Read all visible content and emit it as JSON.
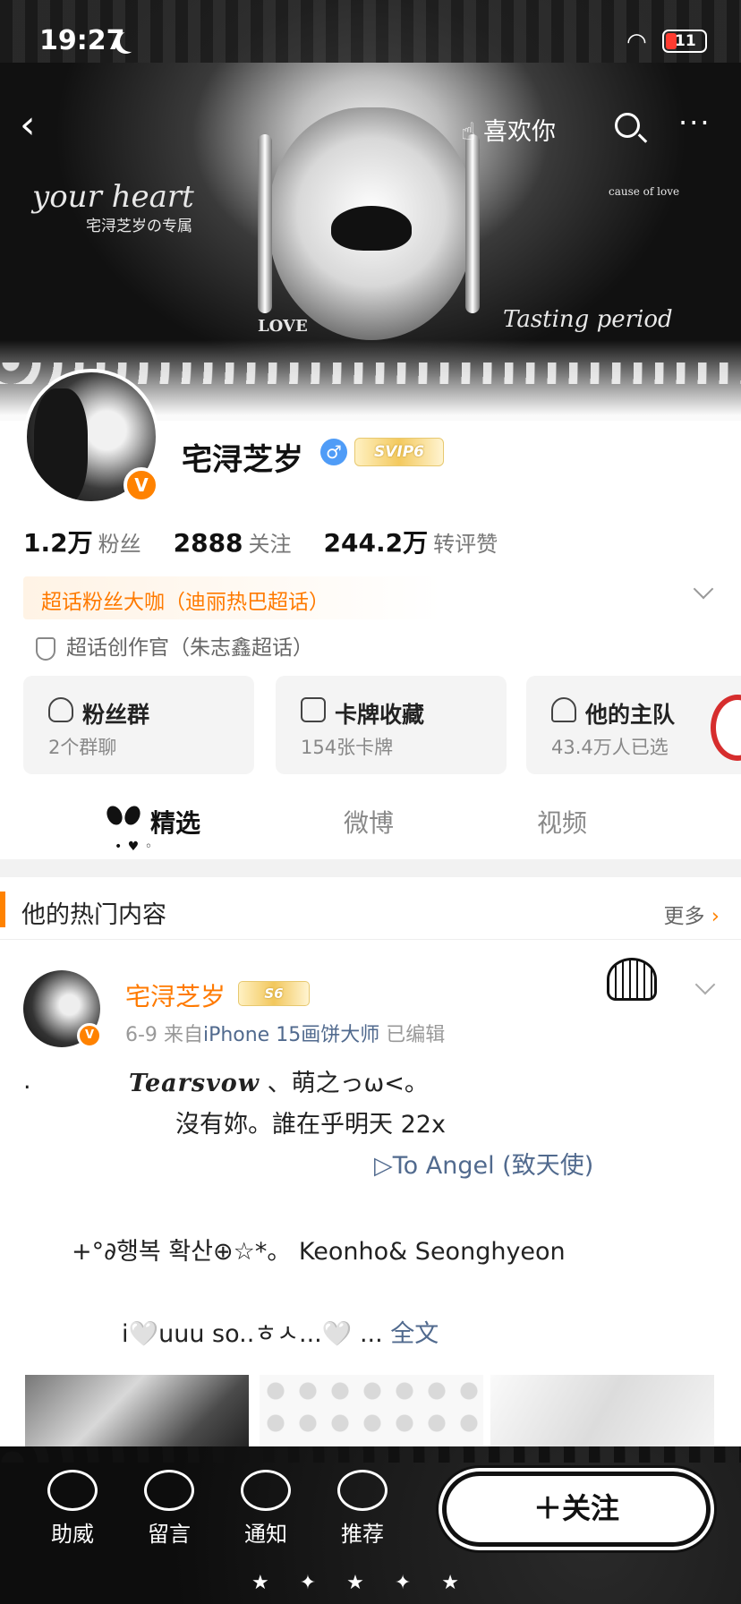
{
  "status_bar": {
    "time": "19:27",
    "battery": "11"
  },
  "nav": {
    "like_label": "喜欢你"
  },
  "banner": {
    "script_text": "your heart",
    "sub_text": "宅浔芝岁の专属",
    "tagline": "Tasting period",
    "love_text": "LOVE",
    "cause_text": "cause of love"
  },
  "profile": {
    "name": "宅浔芝岁",
    "verified_mark": "V",
    "gender_mark": "♂",
    "vip_badge": "SVIP6",
    "stats": [
      {
        "value": "1.2万",
        "label": "粉丝"
      },
      {
        "value": "2888",
        "label": "关注"
      },
      {
        "value": "244.2万",
        "label": "转评赞"
      }
    ],
    "super_fan": "超话粉丝大咖（迪丽热巴超话）",
    "creator": "超话创作官（朱志鑫超话）"
  },
  "cards": [
    {
      "title": "粉丝群",
      "sub": "2个群聊"
    },
    {
      "title": "卡牌收藏",
      "sub": "154张卡牌"
    },
    {
      "title": "他的主队",
      "sub": "43.4万人已选"
    }
  ],
  "tabs": [
    {
      "label": "精选",
      "active": true
    },
    {
      "label": "微博",
      "active": false
    },
    {
      "label": "视频",
      "active": false
    }
  ],
  "section": {
    "title": "他的热门内容",
    "more": "更多",
    "more_arrow": "›"
  },
  "post": {
    "author": "宅浔芝岁",
    "badge": "S6",
    "date": "6-9",
    "from_prefix": "来自",
    "source": "iPhone 15画饼大师",
    "edited": "已编辑",
    "lines": {
      "dot": ".",
      "l1_script": "Tearsvow",
      "l1_rest": "、萌之っω<。",
      "l2": "沒有妳。誰在乎明天 22x",
      "l3": "▷To Angel (致天使)",
      "l4": "+°∂행복 확산⊕☆*。 Keonho& Seonghyeon",
      "l5": "i🤍uuu so..ㅎㅅ...🤍 ...",
      "full_text": "全文"
    }
  },
  "bottom_bar": {
    "items": [
      {
        "label": "助威"
      },
      {
        "label": "留言"
      },
      {
        "label": "通知"
      },
      {
        "label": "推荐"
      }
    ],
    "follow_label": "＋关注"
  }
}
